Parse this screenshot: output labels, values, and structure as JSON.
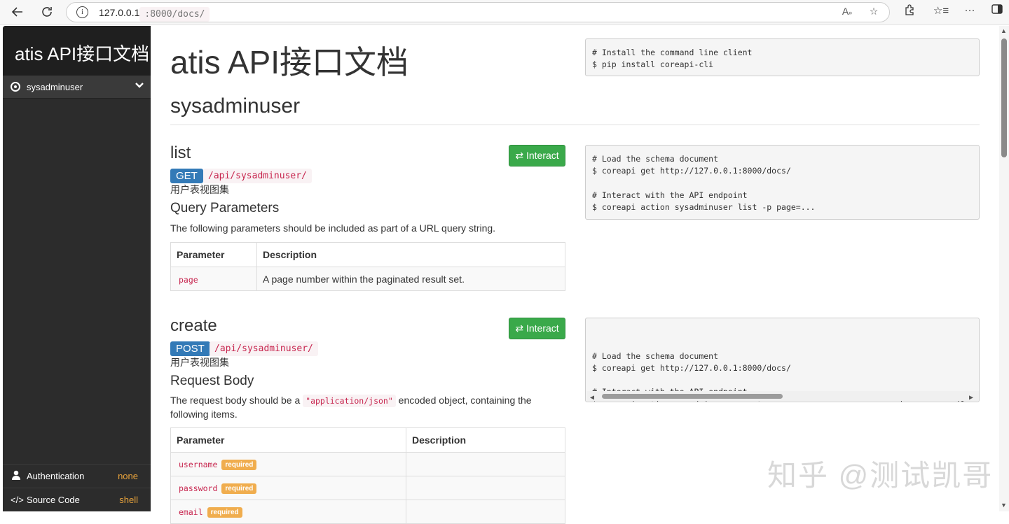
{
  "browser": {
    "url_host": "127.0.0.1",
    "url_path": ":8000/docs/"
  },
  "sidebar": {
    "brand": "atis API接口文档",
    "items": [
      {
        "label": "sysadminuser"
      }
    ],
    "footer": [
      {
        "label": "Authentication",
        "value": "none"
      },
      {
        "label": "Source Code",
        "value": "shell"
      }
    ]
  },
  "main": {
    "title": "atis API接口文档",
    "install_code": "# Install the command line client\n$ pip install coreapi-cli",
    "section_title": "sysadminuser",
    "endpoints": [
      {
        "title": "list",
        "interact_label": "⇄ Interact",
        "method": "GET",
        "path": "/api/sysadminuser/",
        "description": "用户表视图集",
        "params_heading": "Query Parameters",
        "params_text": "The following parameters should be included as part of a URL query string.",
        "table_headers": [
          "Parameter",
          "Description"
        ],
        "rows": [
          {
            "name": "page",
            "description": "A page number within the paginated result set."
          }
        ],
        "code": "# Load the schema document\n$ coreapi get http://127.0.0.1:8000/docs/\n\n# Interact with the API endpoint\n$ coreapi action sysadminuser list -p page=..."
      },
      {
        "title": "create",
        "interact_label": "⇄ Interact",
        "method": "POST",
        "path": "/api/sysadminuser/",
        "description": "用户表视图集",
        "params_heading": "Request Body",
        "params_text_before": "The request body should be a ",
        "params_text_code": "\"application/json\"",
        "params_text_after": " encoded object, containing the following items.",
        "table_headers": [
          "Parameter",
          "Description"
        ],
        "rows": [
          {
            "name": "username",
            "badge": "required"
          },
          {
            "name": "password",
            "badge": "required"
          },
          {
            "name": "email",
            "badge": "required"
          }
        ],
        "code": "# Load the schema document\n$ coreapi get http://127.0.0.1:8000/docs/\n\n# Interact with the API endpoint\n$ coreapi action sysadminuser create -p username=... -p password=... -p email=... -p"
      }
    ]
  },
  "watermark": "知乎 @测试凯哥",
  "colors": {
    "sidebar_bg": "#2c2c2c",
    "get_method": "#337ab7",
    "interact_button": "#3aa94a",
    "required_badge": "#f0ad4e",
    "footer_value": "#e8a33c"
  }
}
